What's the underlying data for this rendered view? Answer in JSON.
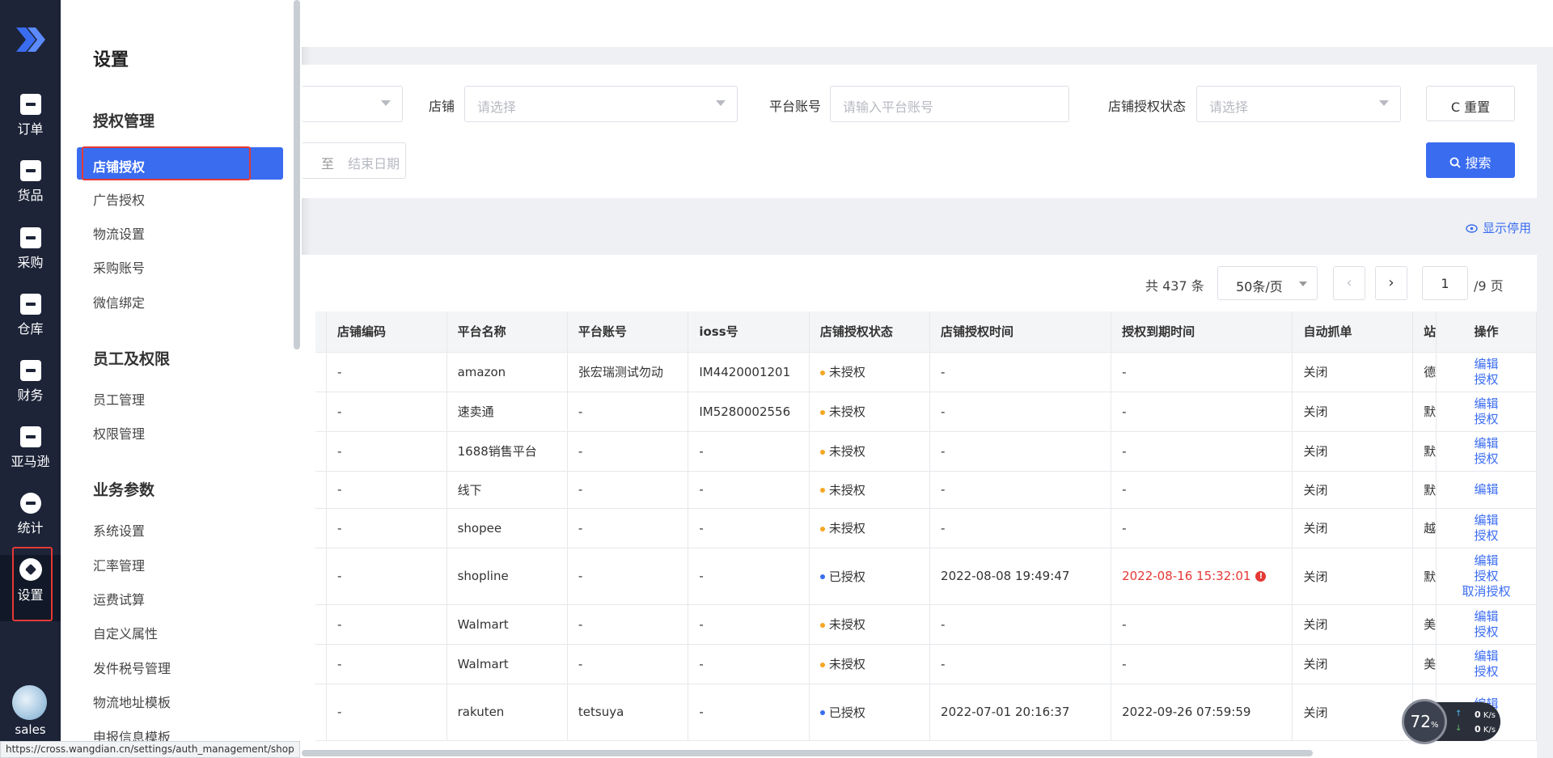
{
  "nav": {
    "items": [
      {
        "label": "订单",
        "icon": "order-icon"
      },
      {
        "label": "货品",
        "icon": "goods-icon"
      },
      {
        "label": "采购",
        "icon": "purchase-icon"
      },
      {
        "label": "仓库",
        "icon": "warehouse-icon"
      },
      {
        "label": "财务",
        "icon": "finance-icon"
      },
      {
        "label": "亚马逊",
        "icon": "amazon-chart-icon"
      },
      {
        "label": "统计",
        "icon": "pie-chart-icon"
      },
      {
        "label": "设置",
        "icon": "settings-icon"
      }
    ],
    "active": "设置",
    "user": "sales"
  },
  "panel": {
    "title": "设置",
    "groups": [
      {
        "title": "授权管理",
        "items": [
          "店铺授权",
          "广告授权",
          "物流设置",
          "采购账号",
          "微信绑定"
        ]
      },
      {
        "title": "员工及权限",
        "items": [
          "员工管理",
          "权限管理"
        ]
      },
      {
        "title": "业务参数",
        "items": [
          "系统设置",
          "汇率管理",
          "运费试算",
          "自定义属性",
          "发件税号管理",
          "物流地址模板",
          "申报信息模板"
        ]
      }
    ],
    "active_item": "店铺授权"
  },
  "filters": {
    "shop_label": "店铺",
    "shop_placeholder": "请选择",
    "account_label": "平台账号",
    "account_placeholder": "请输入平台账号",
    "status_label": "店铺授权状态",
    "status_placeholder": "请选择",
    "date_sep": "至",
    "end_date_placeholder": "结束日期",
    "reset": "C 重置",
    "search": "搜索"
  },
  "show_disabled": "显示停用",
  "pager": {
    "total": "共 437 条",
    "page_size": "50条/页",
    "current": "1",
    "pages": "/9 页"
  },
  "table": {
    "headers": [
      "店铺编码",
      "平台名称",
      "平台账号",
      "ioss号",
      "店铺授权状态",
      "店铺授权时间",
      "授权到期时间",
      "自动抓单",
      "站",
      "操作"
    ],
    "rows": [
      {
        "code": "-",
        "platform": "amazon",
        "account": "张宏瑞测试勿动",
        "ioss": "IM4420001201",
        "status": "未授权",
        "auth_time": "-",
        "expire": "-",
        "auto": "关闭",
        "site": "德",
        "ops": [
          "编辑",
          "授权"
        ]
      },
      {
        "code": "-",
        "platform": "速卖通",
        "account": "-",
        "ioss": "IM5280002556",
        "status": "未授权",
        "auth_time": "-",
        "expire": "-",
        "auto": "关闭",
        "site": "默",
        "ops": [
          "编辑",
          "授权"
        ]
      },
      {
        "code": "-",
        "platform": "1688销售平台",
        "account": "-",
        "ioss": "-",
        "status": "未授权",
        "auth_time": "-",
        "expire": "-",
        "auto": "关闭",
        "site": "默",
        "ops": [
          "编辑",
          "授权"
        ]
      },
      {
        "code": "-",
        "platform": "线下",
        "account": "-",
        "ioss": "-",
        "status": "未授权",
        "auth_time": "-",
        "expire": "-",
        "auto": "关闭",
        "site": "默",
        "ops": [
          "编辑"
        ]
      },
      {
        "code": "-",
        "platform": "shopee",
        "account": "-",
        "ioss": "-",
        "status": "未授权",
        "auth_time": "-",
        "expire": "-",
        "auto": "关闭",
        "site": "越",
        "ops": [
          "编辑",
          "授权"
        ]
      },
      {
        "code": "-",
        "platform": "shopline",
        "account": "-",
        "ioss": "-",
        "status": "已授权",
        "auth_time": "2022-08-08 19:49:47",
        "expire": "2022-08-16 15:32:01",
        "auto": "关闭",
        "site": "默",
        "ops": [
          "编辑",
          "授权",
          "取消授权"
        ]
      },
      {
        "code": "-",
        "platform": "Walmart",
        "account": "-",
        "ioss": "-",
        "status": "未授权",
        "auth_time": "-",
        "expire": "-",
        "auto": "关闭",
        "site": "美",
        "ops": [
          "编辑",
          "授权"
        ]
      },
      {
        "code": "-",
        "platform": "Walmart",
        "account": "-",
        "ioss": "-",
        "status": "未授权",
        "auth_time": "-",
        "expire": "-",
        "auto": "关闭",
        "site": "美",
        "ops": [
          "编辑",
          "授权"
        ]
      },
      {
        "code": "-",
        "platform": "rakuten",
        "account": "tetsuya",
        "ioss": "-",
        "status": "已授权",
        "auth_time": "2022-07-01 20:16:37",
        "expire": "2022-09-26 07:59:59",
        "auto": "关闭",
        "site": "日",
        "ops": [
          "编辑",
          "授权"
        ]
      }
    ]
  },
  "status_url": "https://cross.wangdian.cn/settings/auth_management/shop",
  "speed": {
    "percent": "72",
    "unit": "%",
    "up": "0",
    "down": "0",
    "rate_unit": "K/s"
  },
  "colors": {
    "accent": "#3a6cf0",
    "nav_bg": "#1d2438",
    "warn": "#f6a623",
    "danger": "#e53935"
  }
}
